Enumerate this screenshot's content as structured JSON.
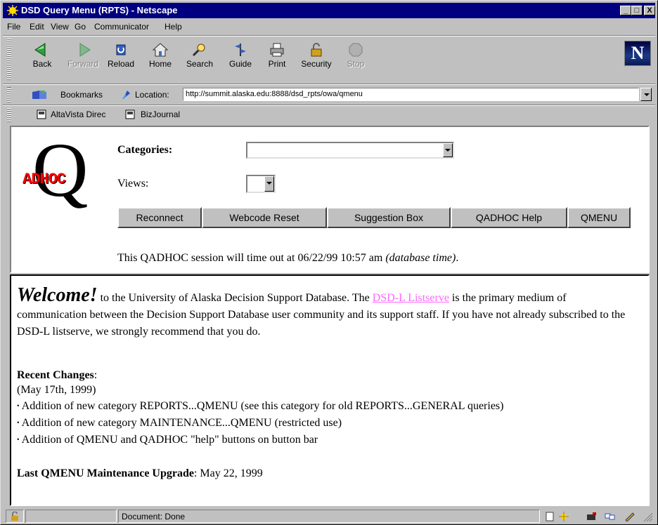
{
  "window": {
    "title": "DSD Query Menu (RPTS) - Netscape",
    "controls": [
      "_",
      "□",
      "X"
    ]
  },
  "menubar": [
    "File",
    "Edit",
    "View",
    "Go",
    "Communicator",
    "Help"
  ],
  "toolbar": {
    "buttons": [
      {
        "label": "Back",
        "icon": "back-arrow-icon",
        "enabled": true
      },
      {
        "label": "Forward",
        "icon": "forward-arrow-icon",
        "enabled": false
      },
      {
        "label": "Reload",
        "icon": "reload-icon",
        "enabled": true
      },
      {
        "label": "Home",
        "icon": "home-icon",
        "enabled": true
      },
      {
        "label": "Search",
        "icon": "search-icon",
        "enabled": true
      },
      {
        "label": "Guide",
        "icon": "guide-icon",
        "enabled": true
      },
      {
        "label": "Print",
        "icon": "print-icon",
        "enabled": true
      },
      {
        "label": "Security",
        "icon": "security-lock-icon",
        "enabled": true
      },
      {
        "label": "Stop",
        "icon": "stop-icon",
        "enabled": false
      }
    ],
    "logo_letter": "N"
  },
  "location": {
    "bookmarks_label": "Bookmarks",
    "location_label": "Location:",
    "url": "http://summit.alaska.edu:8888/dsd_rpts/owa/qmenu"
  },
  "personal_bar": {
    "items": [
      "AltaVista Direc",
      "BizJournal"
    ]
  },
  "query_frame": {
    "logo_text": "ADHOC",
    "logo_letter": "Q",
    "categories_label": "Categories:",
    "categories_value": "",
    "views_label": "Views:",
    "views_value": "",
    "buttons": [
      "Reconnect",
      "Webcode Reset",
      "Suggestion Box",
      "QADHOC Help",
      "QMENU"
    ],
    "timeout_prefix": "This QADHOC session will time out at 06/22/99 10:57 am ",
    "timeout_suffix": "(database time)",
    "timeout_end": "."
  },
  "welcome_frame": {
    "welcome_word": "Welcome!",
    "intro_before_link": " to the University of Alaska Decision Support Database. The ",
    "link_text": "DSD-L Listserve",
    "intro_after_link": " is the primary medium of communication between the Decision Support Database user community and its support staff. If you have not already subscribed to the DSD-L listserve, we strongly recommend that you do.",
    "recent_changes_heading": "Recent Changes",
    "recent_changes_colon": ":",
    "recent_changes_date": "(May 17th, 1999)",
    "changes": [
      "Addition of new category REPORTS...QMENU (see this category for old REPORTS...GENERAL queries)",
      "Addition of new category MAINTENANCE...QMENU (restricted use)",
      "Addition of QMENU and QADHOC \"help\" buttons on button bar"
    ],
    "last_upgrade_label": "Last QMENU Maintenance Upgrade",
    "last_upgrade_value": ": May 22, 1999"
  },
  "statusbar": {
    "status_text": "Document: Done"
  }
}
